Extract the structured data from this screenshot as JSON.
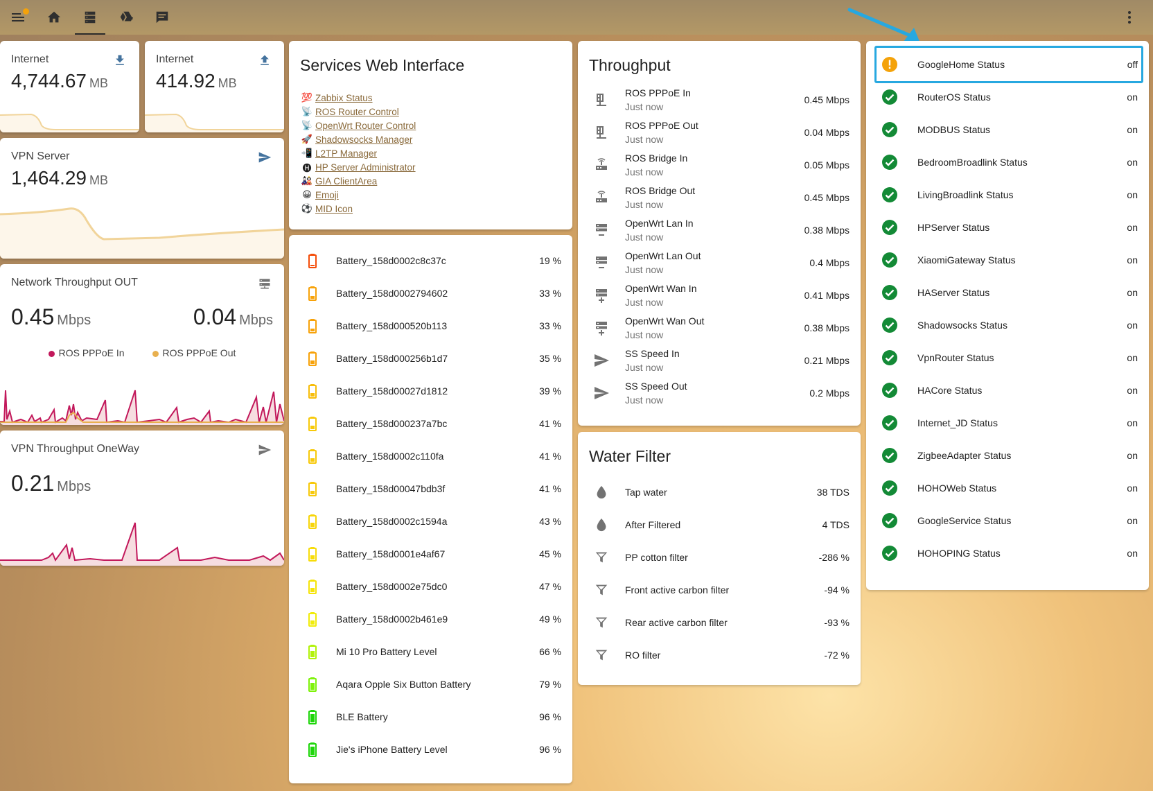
{
  "toolbar": {
    "tabs": [
      "home-icon",
      "server-icon",
      "google-drive-icon",
      "message-icon"
    ],
    "active_tab": 1
  },
  "internet_down": {
    "name": "Internet",
    "value": "4,744.67",
    "unit": "MB"
  },
  "internet_up": {
    "name": "Internet",
    "value": "414.92",
    "unit": "MB"
  },
  "vpn_server": {
    "name": "VPN Server",
    "value": "1,464.29",
    "unit": "MB"
  },
  "net_out": {
    "name": "Network Throughput OUT",
    "value1": "0.45",
    "unit1": "Mbps",
    "value2": "0.04",
    "unit2": "Mbps",
    "legend": [
      "ROS PPPoE In",
      "ROS PPPoE Out"
    ],
    "colors": [
      "#c2185b",
      "#e8b04f"
    ]
  },
  "vpn_oneway": {
    "name": "VPN Throughput OneWay",
    "value": "0.21",
    "unit": "Mbps"
  },
  "services": {
    "title": "Services Web Interface",
    "links": [
      {
        "emoji": "💯",
        "label": "Zabbix Status"
      },
      {
        "emoji": "📡",
        "label": "ROS Router Control"
      },
      {
        "emoji": "📡",
        "label": "OpenWrt Router Control"
      },
      {
        "emoji": "🚀",
        "label": "Shadowsocks Manager"
      },
      {
        "emoji": "📲",
        "label": "L2TP Manager"
      },
      {
        "emoji": "🅗",
        "label": "HP Server Administrator"
      },
      {
        "emoji": "🎎",
        "label": "GIA ClientArea"
      },
      {
        "emoji": "😀",
        "label": "Emoji"
      },
      {
        "emoji": "⚽",
        "label": "MID Icon"
      }
    ]
  },
  "batteries": [
    {
      "name": "Battery_158d0002c8c37c",
      "value": "19 %",
      "level": 19,
      "color": "#f44d0a"
    },
    {
      "name": "Battery_158d0002794602",
      "value": "33 %",
      "level": 33,
      "color": "#f7a20a"
    },
    {
      "name": "Battery_158d000520b113",
      "value": "33 %",
      "level": 33,
      "color": "#f7a20a"
    },
    {
      "name": "Battery_158d000256b1d7",
      "value": "35 %",
      "level": 35,
      "color": "#f7a20a"
    },
    {
      "name": "Battery_158d00027d1812",
      "value": "39 %",
      "level": 39,
      "color": "#f7bd0a"
    },
    {
      "name": "Battery_158d000237a7bc",
      "value": "41 %",
      "level": 41,
      "color": "#f7c90a"
    },
    {
      "name": "Battery_158d0002c110fa",
      "value": "41 %",
      "level": 41,
      "color": "#f7c90a"
    },
    {
      "name": "Battery_158d00047bdb3f",
      "value": "41 %",
      "level": 41,
      "color": "#f7c90a"
    },
    {
      "name": "Battery_158d0002c1594a",
      "value": "43 %",
      "level": 43,
      "color": "#f7d50a"
    },
    {
      "name": "Battery_158d0001e4af67",
      "value": "45 %",
      "level": 45,
      "color": "#f7dc0a"
    },
    {
      "name": "Battery_158d0002e75dc0",
      "value": "47 %",
      "level": 47,
      "color": "#f5e40a"
    },
    {
      "name": "Battery_158d0002b461e9",
      "value": "49 %",
      "level": 49,
      "color": "#f1ec0a"
    },
    {
      "name": "Mi 10 Pro Battery Level",
      "value": "66 %",
      "level": 66,
      "color": "#b2f20a"
    },
    {
      "name": "Aqara Opple Six Button Battery",
      "value": "79 %",
      "level": 79,
      "color": "#7ef20a"
    },
    {
      "name": "BLE Battery",
      "value": "96 %",
      "level": 96,
      "color": "#1ed60a"
    },
    {
      "name": "Jie's iPhone Battery Level",
      "value": "96 %",
      "level": 96,
      "color": "#1ed60a"
    }
  ],
  "throughput": {
    "title": "Throughput",
    "rows": [
      {
        "name": "ROS PPPoE In",
        "sub": "Just now",
        "value": "0.45 Mbps",
        "icon": "router-icon"
      },
      {
        "name": "ROS PPPoE Out",
        "sub": "Just now",
        "value": "0.04 Mbps",
        "icon": "router-icon"
      },
      {
        "name": "ROS Bridge In",
        "sub": "Just now",
        "value": "0.05 Mbps",
        "icon": "router-wireless-icon"
      },
      {
        "name": "ROS Bridge Out",
        "sub": "Just now",
        "value": "0.45 Mbps",
        "icon": "router-wireless-icon"
      },
      {
        "name": "OpenWrt Lan In",
        "sub": "Just now",
        "value": "0.38 Mbps",
        "icon": "server-minus-icon"
      },
      {
        "name": "OpenWrt Lan Out",
        "sub": "Just now",
        "value": "0.4 Mbps",
        "icon": "server-minus-icon"
      },
      {
        "name": "OpenWrt Wan In",
        "sub": "Just now",
        "value": "0.41 Mbps",
        "icon": "server-plus-icon"
      },
      {
        "name": "OpenWrt Wan Out",
        "sub": "Just now",
        "value": "0.38 Mbps",
        "icon": "server-plus-icon"
      },
      {
        "name": "SS Speed In",
        "sub": "Just now",
        "value": "0.21 Mbps",
        "icon": "send-icon"
      },
      {
        "name": "SS Speed Out",
        "sub": "Just now",
        "value": "0.2 Mbps",
        "icon": "send-icon"
      }
    ]
  },
  "water": {
    "title": "Water Filter",
    "rows": [
      {
        "name": "Tap water",
        "value": "38 TDS",
        "icon": "water-drop-icon"
      },
      {
        "name": "After Filtered",
        "value": "4 TDS",
        "icon": "water-drop-icon"
      },
      {
        "name": "PP cotton filter",
        "value": "-286 %",
        "icon": "filter-icon"
      },
      {
        "name": "Front active carbon filter",
        "value": "-94 %",
        "icon": "filter-icon"
      },
      {
        "name": "Rear active carbon filter",
        "value": "-93 %",
        "icon": "filter-icon"
      },
      {
        "name": "RO filter",
        "value": "-72 %",
        "icon": "filter-icon"
      }
    ]
  },
  "statuses": [
    {
      "name": "GoogleHome Status",
      "value": "off",
      "ok": false
    },
    {
      "name": "RouterOS Status",
      "value": "on",
      "ok": true
    },
    {
      "name": "MODBUS Status",
      "value": "on",
      "ok": true
    },
    {
      "name": "BedroomBroadlink Status",
      "value": "on",
      "ok": true
    },
    {
      "name": "LivingBroadlink Status",
      "value": "on",
      "ok": true
    },
    {
      "name": "HPServer Status",
      "value": "on",
      "ok": true
    },
    {
      "name": "XiaomiGateway Status",
      "value": "on",
      "ok": true
    },
    {
      "name": "HAServer Status",
      "value": "on",
      "ok": true
    },
    {
      "name": "Shadowsocks Status",
      "value": "on",
      "ok": true
    },
    {
      "name": "VpnRouter Status",
      "value": "on",
      "ok": true
    },
    {
      "name": "HACore Status",
      "value": "on",
      "ok": true
    },
    {
      "name": "Internet_JD Status",
      "value": "on",
      "ok": true
    },
    {
      "name": "ZigbeeAdapter Status",
      "value": "on",
      "ok": true
    },
    {
      "name": "HOHOWeb Status",
      "value": "on",
      "ok": true
    },
    {
      "name": "GoogleService Status",
      "value": "on",
      "ok": true
    },
    {
      "name": "HOHOPING Status",
      "value": "on",
      "ok": true
    }
  ],
  "colors": {
    "accent": "#27a8e0",
    "ok": "#138a36",
    "warn": "#f4a20a",
    "link": "#8a6a3b",
    "icon_blue": "#44739e"
  }
}
